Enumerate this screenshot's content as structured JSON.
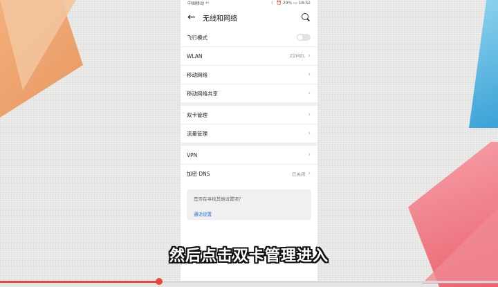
{
  "statusbar": {
    "left": "中国移动 ⁴ᴳ",
    "right": "☾ ⏰ 29% ▭ 18:52"
  },
  "appbar": {
    "back_icon": "←",
    "title": "无线和网络"
  },
  "groups": [
    [
      {
        "label": "飞行模式",
        "type": "toggle",
        "on": false
      },
      {
        "label": "WLAN",
        "value": "ZZMZL",
        "type": "link"
      },
      {
        "label": "移动网络",
        "type": "link"
      },
      {
        "label": "移动网络共享",
        "type": "link"
      }
    ],
    [
      {
        "label": "双卡管理",
        "type": "link"
      },
      {
        "label": "流量管理",
        "type": "link"
      }
    ],
    [
      {
        "label": "VPN",
        "type": "link"
      },
      {
        "label": "加密 DNS",
        "value": "已关闭",
        "type": "link"
      }
    ]
  ],
  "hint": {
    "question": "是否在寻找其他设置项？",
    "link": "通话设置"
  },
  "subtitle": "然后点击双卡管理进入",
  "video_progress": 0.32,
  "colors": {
    "accent": "#e8473b",
    "link": "#1a6fd6"
  }
}
